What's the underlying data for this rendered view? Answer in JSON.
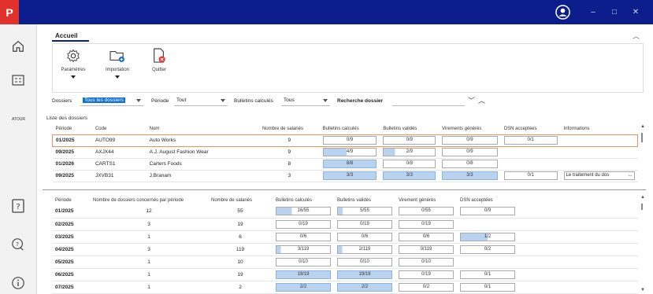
{
  "app": {
    "logo_letter": "P",
    "brand_color": "#e0322b",
    "titlebar_color": "#0c1e8c",
    "accent_color": "#0e6fd6"
  },
  "window": {
    "minimize_glyph": "–",
    "maximize_glyph": "□",
    "close_glyph": "✕",
    "user_icon": "user-circle-icon"
  },
  "sidebar": {
    "items": [
      {
        "icon": "home-icon"
      },
      {
        "icon": "atour-icon",
        "label": "ATOUR"
      },
      {
        "icon": "help-book-icon"
      },
      {
        "icon": "support-chat-icon"
      },
      {
        "icon": "info-icon"
      }
    ]
  },
  "ribbon": {
    "tab": "Accueil",
    "buttons": [
      {
        "label": "Paramètres",
        "icon": "gear-icon"
      },
      {
        "label": "Importation",
        "icon": "folder-import-icon"
      },
      {
        "label": "Quitter",
        "icon": "exit-document-icon"
      }
    ]
  },
  "filters": {
    "dossiers_label": "Dossiers",
    "dossiers_value": "Tous les dossiers",
    "periode_label": "Période",
    "periode_value": "Tout",
    "bulletins_label": "Bulletins calculés",
    "bulletins_value": "Tous",
    "search_label": "Recherche dossier",
    "search_value": ""
  },
  "dossiers_section": {
    "title": "Liste des dossiers",
    "columns": [
      "Période",
      "Code",
      "Nom",
      "Nombre de salariés",
      "Bulletins calculés",
      "Bulletins validés",
      "Virements générés",
      "DSN acceptées",
      "Informations"
    ],
    "rows": [
      {
        "periode": "01/2025",
        "code": "AUTO99",
        "nom": "Auto Works",
        "salaries": "9",
        "calc": "0/9",
        "calc_fill": 0,
        "valid": "0/9",
        "valid_fill": 0,
        "vir": "0/9",
        "vir_fill": 0,
        "dsn": "0/1",
        "dsn_fill": 0,
        "info": ""
      },
      {
        "periode": "09/2025",
        "code": "AXJX44",
        "nom": "A.J. August Fashion Wear",
        "salaries": "9",
        "calc": "4/9",
        "calc_fill": 0.44,
        "valid": "2/9",
        "valid_fill": 0.22,
        "vir": "0/9",
        "vir_fill": 0,
        "dsn": "",
        "dsn_fill": 0,
        "info": ""
      },
      {
        "periode": "01/2026",
        "code": "CARTS1",
        "nom": "Carters Foods",
        "salaries": "8",
        "calc": "8/8",
        "calc_fill": 1,
        "valid": "0/8",
        "valid_fill": 0,
        "vir": "0/8",
        "vir_fill": 0,
        "dsn": "",
        "dsn_fill": 0,
        "info": ""
      },
      {
        "periode": "09/2025",
        "code": "JXVB31",
        "nom": "J.Branam",
        "salaries": "3",
        "calc": "3/3",
        "calc_fill": 1,
        "valid": "3/3",
        "valid_fill": 1,
        "vir": "3/3",
        "vir_fill": 1,
        "dsn": "0/1",
        "dsn_fill": 0,
        "info": "Le traitement du dos"
      }
    ]
  },
  "periodes_section": {
    "columns": [
      "Période",
      "Nombre de dossiers concernés par période",
      "Nombre de salariés",
      "Bulletins calculés",
      "Bulletins validés",
      "Virement générés",
      "DSN acceptées"
    ],
    "rows": [
      {
        "periode": "01/2025",
        "dossiers": "12",
        "salaries": "55",
        "calc": "16/55",
        "calc_fill": 0.29,
        "valid": "5/55",
        "valid_fill": 0.09,
        "vir": "0/55",
        "vir_fill": 0,
        "dsn": "0/9",
        "dsn_fill": 0
      },
      {
        "periode": "02/2025",
        "dossiers": "3",
        "salaries": "19",
        "calc": "0/19",
        "calc_fill": 0,
        "valid": "0/19",
        "valid_fill": 0,
        "vir": "0/19",
        "vir_fill": 0,
        "dsn": "",
        "dsn_fill": 0
      },
      {
        "periode": "03/2025",
        "dossiers": "1",
        "salaries": "6",
        "calc": "0/6",
        "calc_fill": 0,
        "valid": "0/6",
        "valid_fill": 0,
        "vir": "0/6",
        "vir_fill": 0,
        "dsn": "1/2",
        "dsn_fill": 0.5
      },
      {
        "periode": "04/2025",
        "dossiers": "3",
        "salaries": "119",
        "calc": "3/119",
        "calc_fill": 0.03,
        "valid": "2/119",
        "valid_fill": 0.02,
        "vir": "0/119",
        "vir_fill": 0,
        "dsn": "0/2",
        "dsn_fill": 0
      },
      {
        "periode": "05/2025",
        "dossiers": "1",
        "salaries": "10",
        "calc": "0/10",
        "calc_fill": 0,
        "valid": "0/10",
        "valid_fill": 0,
        "vir": "0/10",
        "vir_fill": 0,
        "dsn": "",
        "dsn_fill": 0
      },
      {
        "periode": "06/2025",
        "dossiers": "1",
        "salaries": "19",
        "calc": "19/19",
        "calc_fill": 1,
        "valid": "19/19",
        "valid_fill": 1,
        "vir": "0/19",
        "vir_fill": 0,
        "dsn": "0/1",
        "dsn_fill": 0
      },
      {
        "periode": "07/2025",
        "dossiers": "1",
        "salaries": "2",
        "calc": "2/2",
        "calc_fill": 1,
        "valid": "2/2",
        "valid_fill": 1,
        "vir": "0/2",
        "vir_fill": 0,
        "dsn": "0/1",
        "dsn_fill": 0
      }
    ]
  }
}
